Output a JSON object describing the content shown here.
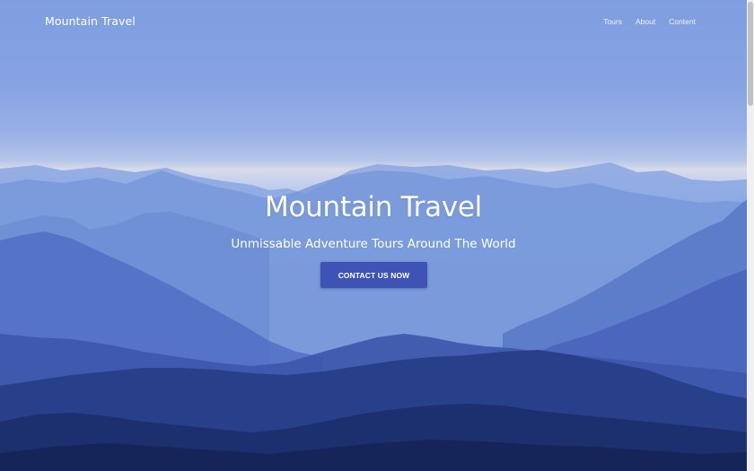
{
  "navbar": {
    "brand": "Mountain Travel",
    "links": [
      "Tours",
      "About",
      "Content"
    ]
  },
  "hero": {
    "title": "Mountain Travel",
    "subtitle": "Unmissable Adventure Tours Around The World",
    "cta_label": "CONTACT US NOW"
  },
  "colors": {
    "accent": "#3f52b5",
    "sky": "#7f9ee0",
    "text": "#ffffff"
  },
  "icons": [
    "mountain-landscape-image"
  ]
}
